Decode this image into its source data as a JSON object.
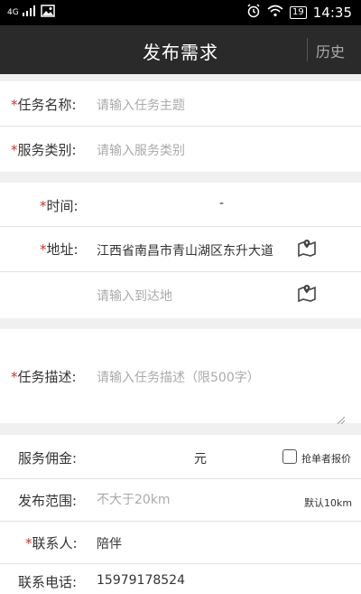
{
  "status_bar": {
    "network": "4G",
    "battery": "19",
    "time": "14:35"
  },
  "header": {
    "title": "发布需求",
    "history_label": "历史"
  },
  "form": {
    "task_name": {
      "star": "*",
      "label": "任务名称:",
      "placeholder": "请输入任务主题"
    },
    "service_type": {
      "star": "*",
      "label": "服务类别:",
      "placeholder": "请输入服务类别"
    },
    "time": {
      "star": "*",
      "label": "时间:",
      "value": "-"
    },
    "address": {
      "star": "*",
      "label": "地址:",
      "value": "江西省南昌市青山湖区东升大道"
    },
    "destination": {
      "placeholder": "请输入到达地"
    },
    "description": {
      "star": "*",
      "label": "任务描述:",
      "placeholder": "请输入任务描述（限500字）"
    },
    "commission": {
      "label": "服务佣金:",
      "unit": "元",
      "checkbox_label": "抢单者报价"
    },
    "range": {
      "label": "发布范围:",
      "placeholder": "不大于20km",
      "default_note": "默认10km"
    },
    "contact": {
      "star": "*",
      "label": "联系人:",
      "value": "陪伴"
    },
    "phone": {
      "label": "联系电话:",
      "value": "15979178524"
    }
  },
  "icons": {
    "map": "map-pin-icon",
    "clock": "alarm-icon",
    "wifi": "wifi-icon"
  }
}
